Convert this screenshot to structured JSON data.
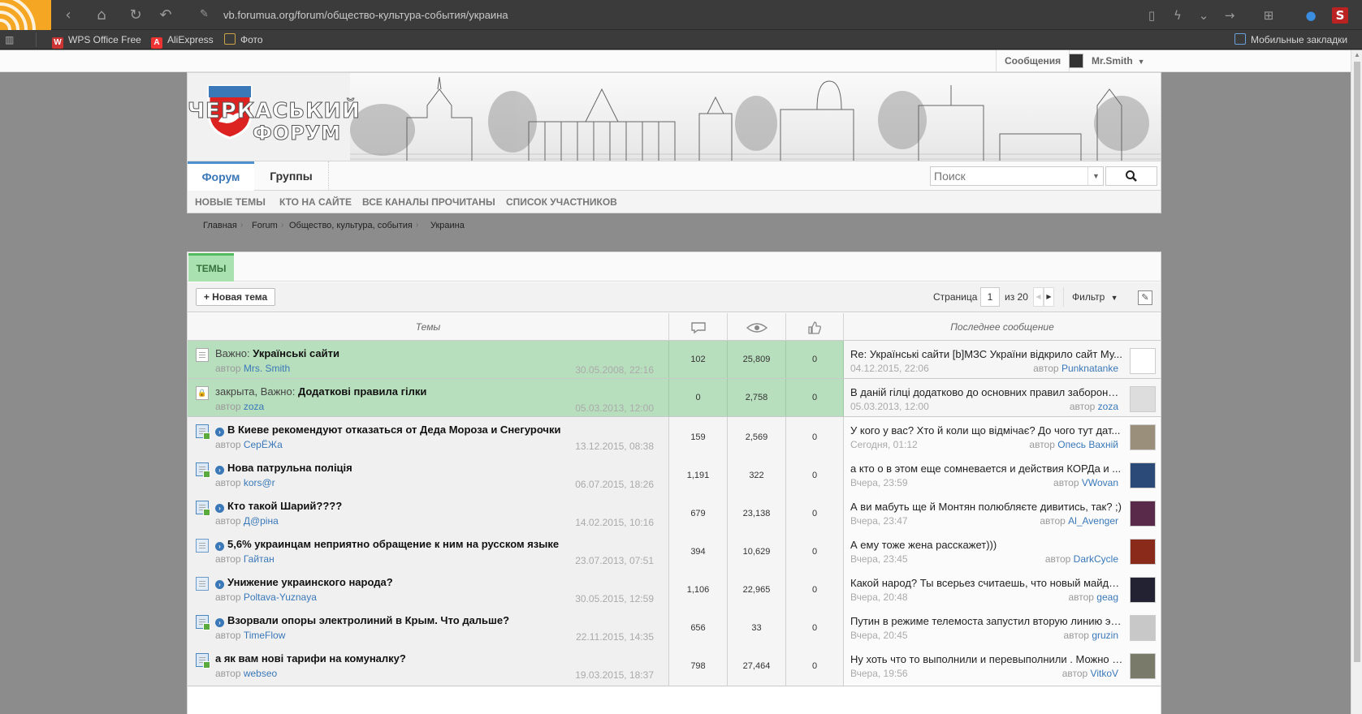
{
  "browser": {
    "url": "vb.forumua.org/forum/общество-культура-события/украина",
    "bookmarks": [
      "WPS Office Free",
      "AliExpress",
      "Фото"
    ],
    "mobile_bookmarks": "Мобильные закладки"
  },
  "topbar": {
    "messages": "Сообщения",
    "username": "Mr.Smith"
  },
  "header": {
    "logo_line1": "ЧЕРКАСЬКИЙ",
    "logo_line2": "ФОРУМ"
  },
  "nav": {
    "tabs": [
      "Форум",
      "Группы"
    ],
    "search_placeholder": "Поиск",
    "subnav": [
      "НОВЫЕ ТЕМЫ",
      "КТО НА САЙТЕ",
      "ВСЕ КАНАЛЫ ПРОЧИТАНЫ",
      "СПИСОК УЧАСТНИКОВ"
    ]
  },
  "breadcrumb": [
    "Главная",
    "Forum",
    "Общество, культура, события",
    "Украина"
  ],
  "panel": {
    "tab_label": "ТЕМЫ",
    "new_topic": "+ Новая тема",
    "page_label": "Страница",
    "page_current": "1",
    "page_of": "из 20",
    "filter": "Фильтр",
    "col_topics": "Темы",
    "col_last": "Последнее сообщение"
  },
  "topics": [
    {
      "prefix": "Важно: ",
      "title": "Українські сайти",
      "author_label": "автор ",
      "author": "Mrs. Smith",
      "date": "30.05.2008, 22:16",
      "replies": "102",
      "views": "25,809",
      "likes": "0",
      "last_text": "Re: Українські сайти [b]МЗС України відкрило сайт Му...",
      "last_date": "04.12.2015, 22:06",
      "last_author": "Punknatanke"
    },
    {
      "prefix": "закрыта, Важно: ",
      "title": "Додаткові правила гілки",
      "author_label": "автор ",
      "author": "zoza",
      "date": "05.03.2013, 12:00",
      "replies": "0",
      "views": "2,758",
      "likes": "0",
      "last_text": "В даній гілці додатково до основних правил заборонене...",
      "last_date": "05.03.2013, 12:00",
      "last_author": "zoza"
    },
    {
      "prefix": "",
      "title": "В Киеве рекомендуют отказаться от Деда Мороза и Снегурочки",
      "author_label": "автор ",
      "author": "СерЁЖа",
      "date": "13.12.2015, 08:38",
      "replies": "159",
      "views": "2,569",
      "likes": "0",
      "last_text": "У кого у вас? Хто й коли що відмічає? До чого тут дат...",
      "last_date": "Сегодня, 01:12",
      "last_author": "Опесь Вахній"
    },
    {
      "prefix": "",
      "title": "Нова патрульна поліція",
      "author_label": "автор ",
      "author": "kors@r",
      "date": "06.07.2015, 18:26",
      "replies": "1,191",
      "views": "322",
      "likes": "0",
      "last_text": "а кто о в этом еще сомневается и действия КОРДа и ...",
      "last_date": "Вчера, 23:59",
      "last_author": "VWovan"
    },
    {
      "prefix": "",
      "title": "Кто такой Шарий????",
      "author_label": "автор ",
      "author": "Д@ріна",
      "date": "14.02.2015, 10:16",
      "replies": "679",
      "views": "23,138",
      "likes": "0",
      "last_text": "А ви мабуть ще й Монтян полюбляєте дивитись, так? ;)",
      "last_date": "Вчера, 23:47",
      "last_author": "Al_Avenger"
    },
    {
      "prefix": "",
      "title": "5,6% украинцам неприятно обращение к ним на русском языке",
      "author_label": "автор ",
      "author": "Гайтан",
      "date": "23.07.2013, 07:51",
      "replies": "394",
      "views": "10,629",
      "likes": "0",
      "last_text": "А ему тоже жена расскажет)))",
      "last_date": "Вчера, 23:45",
      "last_author": "DarkCycle"
    },
    {
      "prefix": "",
      "title": "Унижение украинского народа?",
      "author_label": "автор ",
      "author": "Poltava-Yuznaya",
      "date": "30.05.2015, 12:59",
      "replies": "1,106",
      "views": "22,965",
      "likes": "0",
      "last_text": "Какой народ? Ты всерьез считаешь, что новый майда...",
      "last_date": "Вчера, 20:48",
      "last_author": "geag"
    },
    {
      "prefix": "",
      "title": "Взорвали опоры электролиний в Крым. Что дальше?",
      "author_label": "автор ",
      "author": "TimeFlow",
      "date": "22.11.2015, 14:35",
      "replies": "656",
      "views": "33",
      "likes": "0",
      "last_text": "Путин в режиме телемоста запустил вторую линию эн...",
      "last_date": "Вчера, 20:45",
      "last_author": "gruzin"
    },
    {
      "prefix": "",
      "title": "а як вам нові тарифи на комуналку?",
      "author_label": "автор ",
      "author": "webseo",
      "date": "19.03.2015, 18:37",
      "replies": "798",
      "views": "27,464",
      "likes": "0",
      "last_text": "Ну хоть что то выполнили и перевыполнили . Можно з...",
      "last_date": "Вчера, 19:56",
      "last_author": "VitkoV"
    }
  ],
  "colors": {
    "accent": "#3a78b8",
    "sticky_bg": "#b8dfbd",
    "tab_green": "#a9e2b0",
    "page_bg": "#8c8c8c"
  }
}
